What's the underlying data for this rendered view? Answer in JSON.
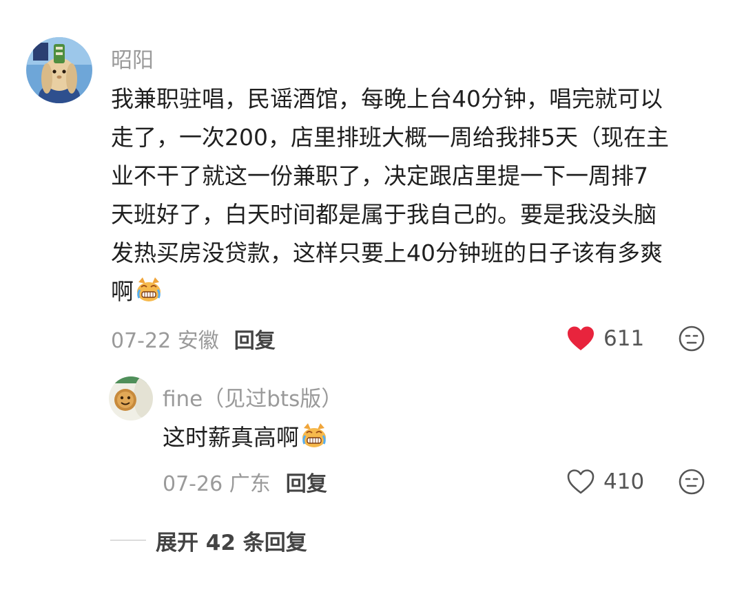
{
  "comment": {
    "username": "昭阳",
    "lines": [
      "我兼职驻唱，民谣酒馆，每晚上台40分钟，唱完就可以",
      "走了，一次200，店里排班大概一周给我排5天（现在主",
      "业不干了就这一份兼职了，决定跟店里提一下一周排7",
      "天班好了，白天时间都是属于我自己的。要是我没头脑",
      "发热买房没贷款，这样只要上40分钟班的日子该有多爽",
      "啊"
    ],
    "emoji_icon": "crying-cat-emoji",
    "date_location": "07-22 安徽",
    "reply_label": "回复",
    "likes": "611",
    "liked": true,
    "like_color": "#e8243d"
  },
  "reply": {
    "username": "fine（见过bts版）",
    "text": "这时薪真高啊",
    "emoji_icon": "crying-cat-emoji",
    "date_location": "07-26 广东",
    "reply_label": "回复",
    "likes": "410",
    "liked": false
  },
  "expand": {
    "label": "展开 42 条回复"
  }
}
